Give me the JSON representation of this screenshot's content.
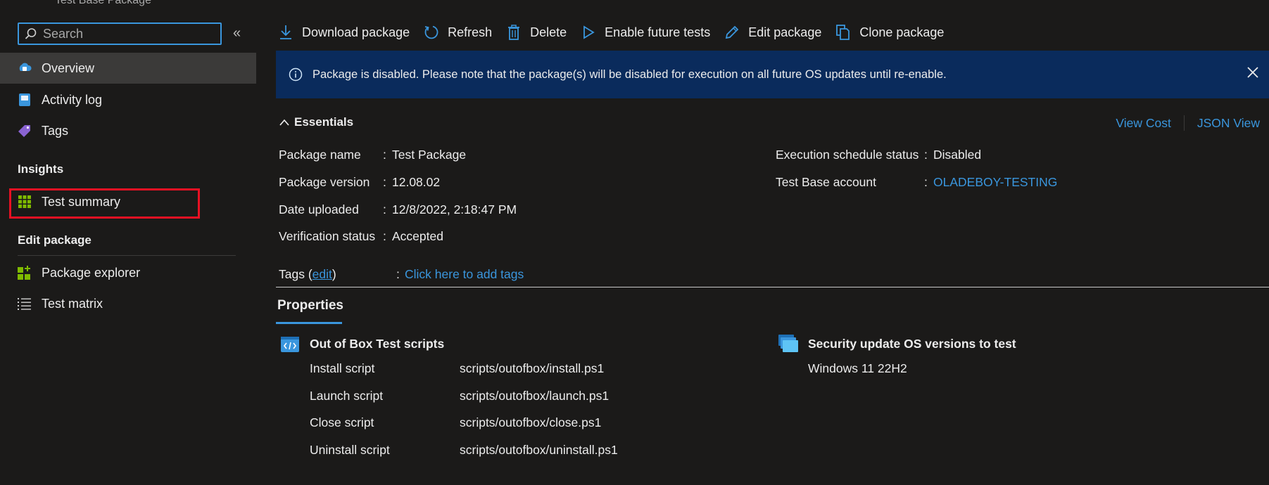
{
  "header": {
    "resource_type": "Test Base Package"
  },
  "search": {
    "placeholder": "Search"
  },
  "sidebar": {
    "collapse_glyph": "«",
    "items": [
      {
        "label": "Overview",
        "icon": "overview-icon"
      },
      {
        "label": "Activity log",
        "icon": "activity-log-icon"
      },
      {
        "label": "Tags",
        "icon": "tag-icon"
      }
    ],
    "insights_title": "Insights",
    "insights_items": [
      {
        "label": "Test summary",
        "icon": "grid-icon"
      }
    ],
    "edit_title": "Edit package",
    "edit_items": [
      {
        "label": "Package explorer",
        "icon": "package-explorer-icon"
      },
      {
        "label": "Test matrix",
        "icon": "list-icon"
      }
    ]
  },
  "toolbar": {
    "download": "Download package",
    "refresh": "Refresh",
    "delete": "Delete",
    "enable": "Enable future tests",
    "edit": "Edit package",
    "clone": "Clone package"
  },
  "banner": {
    "text": "Package is disabled. Please note that the package(s) will be disabled for execution on all future OS updates until re-enable."
  },
  "essentials": {
    "title": "Essentials",
    "view_cost": "View Cost",
    "json_view": "JSON View",
    "left": [
      {
        "label": "Package name",
        "value": "Test Package"
      },
      {
        "label": "Package version",
        "value": "12.08.02"
      },
      {
        "label": "Date uploaded",
        "value": "12/8/2022, 2:18:47 PM"
      },
      {
        "label": "Verification status",
        "value": "Accepted"
      }
    ],
    "right": [
      {
        "label": "Execution schedule status",
        "value": "Disabled"
      },
      {
        "label": "Test Base account",
        "value": "OLADEBOY-TESTING"
      }
    ],
    "tags_label": "Tags (",
    "tags_edit": "edit",
    "tags_close": ")",
    "tags_value": "Click here to add tags",
    "colon": ":"
  },
  "properties": {
    "tab": "Properties",
    "scripts_title": "Out of Box Test scripts",
    "scripts": [
      {
        "label": "Install script",
        "value": "scripts/outofbox/install.ps1"
      },
      {
        "label": "Launch script",
        "value": "scripts/outofbox/launch.ps1"
      },
      {
        "label": "Close script",
        "value": "scripts/outofbox/close.ps1"
      },
      {
        "label": "Uninstall script",
        "value": "scripts/outofbox/uninstall.ps1"
      }
    ],
    "os_title": "Security update OS versions to test",
    "os_values": [
      "Windows 11 22H2"
    ]
  },
  "colors": {
    "accent": "#3a96dd",
    "banner_bg": "#0a2b5c",
    "highlight": "#e81123",
    "background": "#1b1a19"
  }
}
